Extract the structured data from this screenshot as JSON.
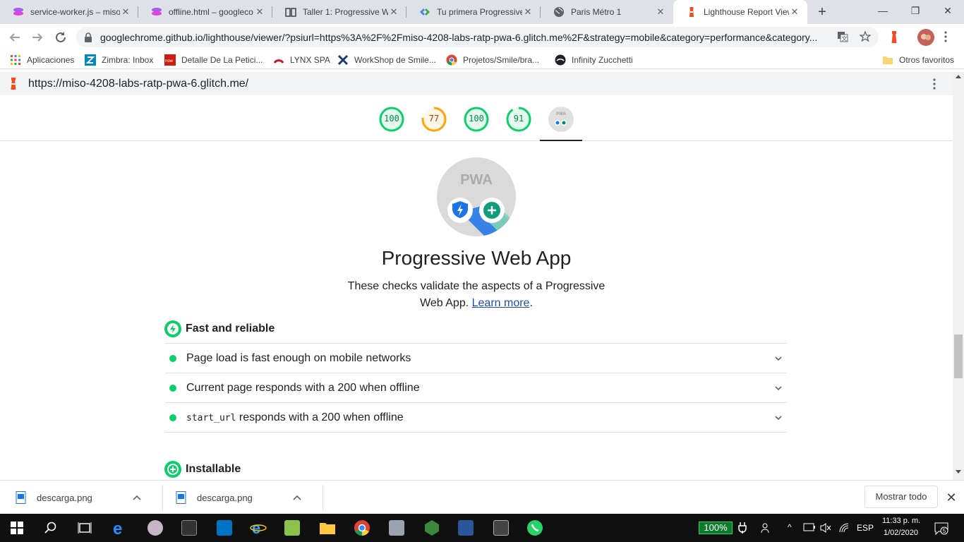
{
  "tabs": [
    {
      "title": "service-worker.js – miso",
      "icon": "glitch-icon"
    },
    {
      "title": "offline.html – googleco",
      "icon": "glitch-icon"
    },
    {
      "title": "Taller 1: Progressive We",
      "icon": "book-icon"
    },
    {
      "title": "Tu primera Progressive",
      "icon": "google-dev-icon"
    },
    {
      "title": "Paris Métro 1",
      "icon": "globe-icon"
    },
    {
      "title": "Lighthouse Report View",
      "icon": "lighthouse-icon",
      "active": true
    }
  ],
  "url": "googlechrome.github.io/lighthouse/viewer/?psiurl=https%3A%2F%2Fmiso-4208-labs-ratp-pwa-6.glitch.me%2F&strategy=mobile&category=performance&category...",
  "bookmarks": [
    {
      "label": "Aplicaciones",
      "icon": "apps-icon"
    },
    {
      "label": "Zimbra: Inbox",
      "icon": "zimbra-icon"
    },
    {
      "label": "Detalle De La Petici...",
      "icon": "now-icon"
    },
    {
      "label": "LYNX SPA",
      "icon": "lynx-icon"
    },
    {
      "label": "WorkShop de Smile...",
      "icon": "workshop-icon"
    },
    {
      "label": "Projetos/Smile/bra...",
      "icon": "chrome-icon"
    },
    {
      "label": "Infinity Zucchetti",
      "icon": "infinity-icon"
    }
  ],
  "other_bookmarks": "Otros favoritos",
  "report": {
    "url": "https://miso-4208-labs-ratp-pwa-6.glitch.me/",
    "gauges": [
      {
        "value": "100",
        "color": "#0cce6b"
      },
      {
        "value": "77",
        "color": "#ffa400"
      },
      {
        "value": "100",
        "color": "#0cce6b"
      },
      {
        "value": "91",
        "color": "#0cce6b"
      }
    ],
    "pwa_badge_text": "PWA",
    "title": "Progressive Web App",
    "description": "These checks validate the aspects of a Progressive Web App.",
    "learn_more": "Learn more",
    "groups": [
      {
        "title": "Fast and reliable",
        "audits": [
          {
            "pre": "",
            "code": "",
            "text": "Page load is fast enough on mobile networks"
          },
          {
            "pre": "",
            "code": "",
            "text": "Current page responds with a 200 when offline"
          },
          {
            "pre": "",
            "code": "start_url",
            "text": " responds with a 200 when offline"
          }
        ]
      },
      {
        "title": "Installable",
        "audits": []
      }
    ]
  },
  "downloads": [
    {
      "name": "descarga.png"
    },
    {
      "name": "descarga.png"
    }
  ],
  "show_all": "Mostrar todo",
  "taskbar": {
    "battery": "100%",
    "lang": "ESP",
    "time": "11:33 p. m.",
    "date": "1/02/2020",
    "notifications": "5"
  }
}
